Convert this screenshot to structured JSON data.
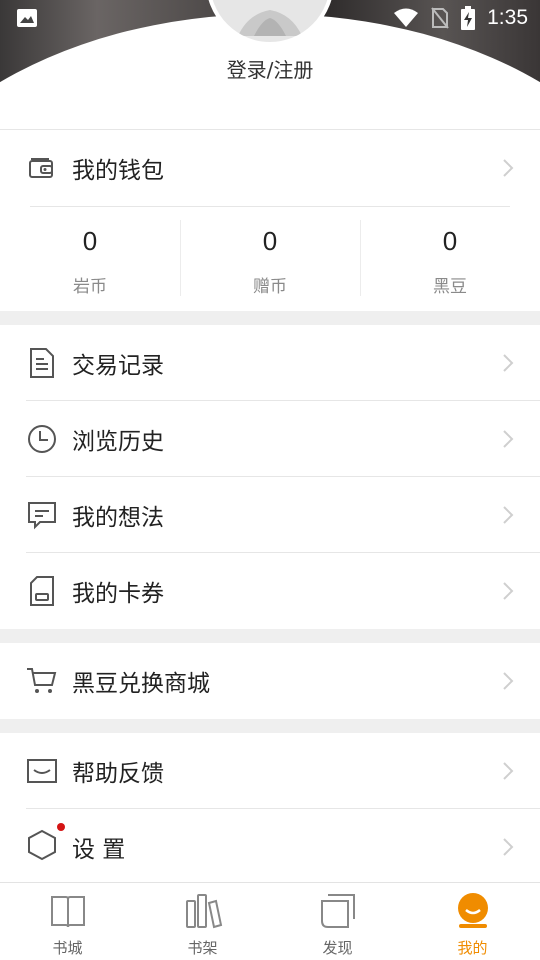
{
  "status_bar": {
    "time": "1:35"
  },
  "header": {
    "login_label": "登录/注册"
  },
  "wallet": {
    "label": "我的钱包",
    "stats": [
      {
        "value": "0",
        "label": "岩币"
      },
      {
        "value": "0",
        "label": "赠币"
      },
      {
        "value": "0",
        "label": "黑豆"
      }
    ]
  },
  "menu": {
    "transactions": "交易记录",
    "history": "浏览历史",
    "thoughts": "我的想法",
    "coupons": "我的卡券",
    "exchange_store": "黑豆兑换商城",
    "help_feedback": "帮助反馈",
    "settings": "设 置"
  },
  "bottom_nav": {
    "items": [
      {
        "label": "书城",
        "icon": "open-book-icon"
      },
      {
        "label": "书架",
        "icon": "bookshelf-icon"
      },
      {
        "label": "发现",
        "icon": "discover-icon"
      },
      {
        "label": "我的",
        "icon": "profile-icon"
      }
    ],
    "active_index": 3,
    "active_color": "#f08c00"
  },
  "colors": {
    "accent": "#f08c00",
    "badge": "#d41414"
  }
}
